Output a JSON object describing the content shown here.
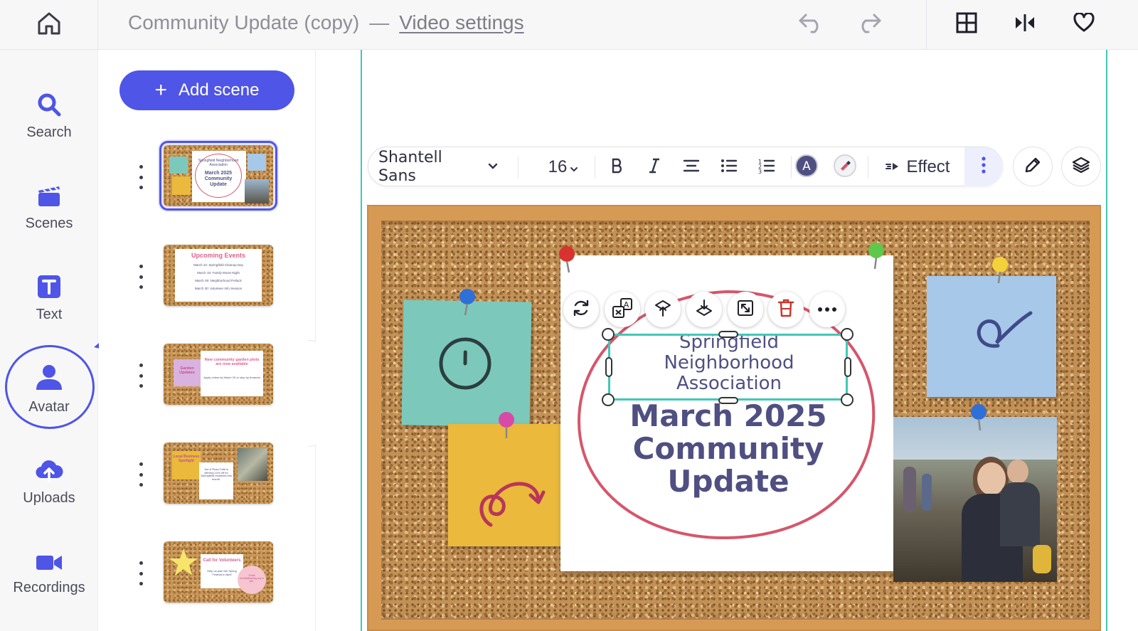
{
  "topbar": {
    "title": "Community Update (copy)",
    "separator": "—",
    "settings_link": "Video settings",
    "icons": [
      "home-icon",
      "undo-icon",
      "redo-icon",
      "grid-icon",
      "split-icon",
      "heart-icon"
    ]
  },
  "rail": {
    "items": [
      {
        "label": "Search",
        "icon": "search-icon"
      },
      {
        "label": "Scenes",
        "icon": "clapperboard-icon"
      },
      {
        "label": "Text",
        "icon": "text-icon"
      },
      {
        "label": "Avatar",
        "icon": "avatar-icon"
      },
      {
        "label": "Uploads",
        "icon": "upload-cloud-icon"
      },
      {
        "label": "Recordings",
        "icon": "video-camera-icon"
      }
    ]
  },
  "scenes": {
    "add_label": "Add scene",
    "thumbnails": [
      {
        "title_small": "Springfield Neighborhood Association",
        "title": "March 2025 Community Update",
        "selected": true
      },
      {
        "title": "Upcoming Events",
        "lines": [
          "March 22: Springfield Cleanup Day",
          "March 15: Family Movie Night",
          "March 29: Neighborhood Potluck",
          "March 30: Volunteer Info Session"
        ],
        "selected": false
      },
      {
        "note": "Garden Updates",
        "title": "New community garden plots are now available",
        "sub": "Apply online by March 20 or stop by Amanda",
        "selected": false
      },
      {
        "note": "Local Business Spotlight",
        "title": "Joe & Rosa Café is offering 10% off for Springfield residents this month.",
        "selected": false
      },
      {
        "title": "Call for Volunteers",
        "sub": "Help us plan the Spring Festival in April",
        "circle": "Email events@spring.org to join.",
        "selected": false
      }
    ]
  },
  "toolbar": {
    "font": "Shantell Sans",
    "size": "16",
    "effect_label": "Effect"
  },
  "canvas": {
    "subhead": "Springfield Neighborhood Association",
    "headline": "March 2025 Community Update"
  },
  "colors": {
    "accent": "#4f55e6",
    "guide": "#43c7b7",
    "text_purple": "#4f4f82",
    "ellipse_red": "#d6566b",
    "sticky_teal": "#7cc9bc",
    "sticky_yellow": "#ebb93c",
    "sticky_blue": "#a7c8e8"
  }
}
